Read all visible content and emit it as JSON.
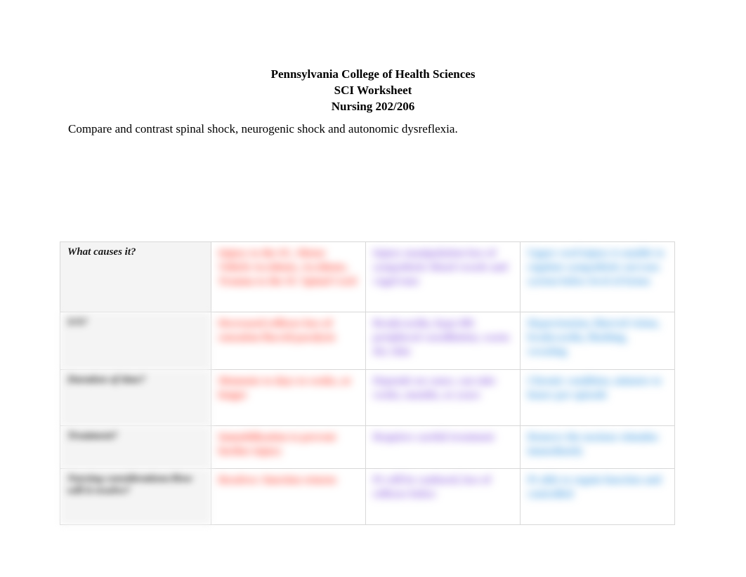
{
  "header": {
    "line1": "Pennsylvania College of Health Sciences",
    "line2": "SCI Worksheet",
    "line3": "Nursing 202/206"
  },
  "instruction": "Compare and contrast spinal shock, neurogenic shock and autonomic dysreflexia.",
  "rows": {
    "r1": {
      "label": "What causes it?",
      "spinal": "Injury to the SC, Motor Vehicle Accidents, Accidents, Trauma to the SC Spinal Cord",
      "neuro": "Injury manipulation loss of sympathetic blood vessels and vagal tone",
      "auto": "Upper cord injury is unable to regulate sympathetic nervous system below level of lesion"
    },
    "r2": {
      "label": "S/S?",
      "spinal": "Decreased reflexes loss of sensation flaccid paralysis",
      "neuro": "Bradycardia, hypo BP, peripheral vasodilation, warm dry skin",
      "auto": "Hypertension, blurred vision, bradycardia, flushing, sweating"
    },
    "r3": {
      "label": "Duration of time?",
      "spinal": "Moments to days to weeks, or longer",
      "neuro": "Depends on cause, can take weeks, months, or years",
      "auto": "Chronic condition, minutes to hours per episode"
    },
    "r4": {
      "label": "Treatment?",
      "spinal": "Immobilization to prevent further injury",
      "neuro": "Requires careful treatment",
      "auto": "Remove the noxious stimulus immediately"
    },
    "r5": {
      "label": "Nursing considerations/How will it resolve?",
      "spinal": "Resolves: function returns",
      "neuro": "Pt will be confused, loss of reflexes below",
      "auto": "Pt able to regain function and controlled"
    }
  }
}
